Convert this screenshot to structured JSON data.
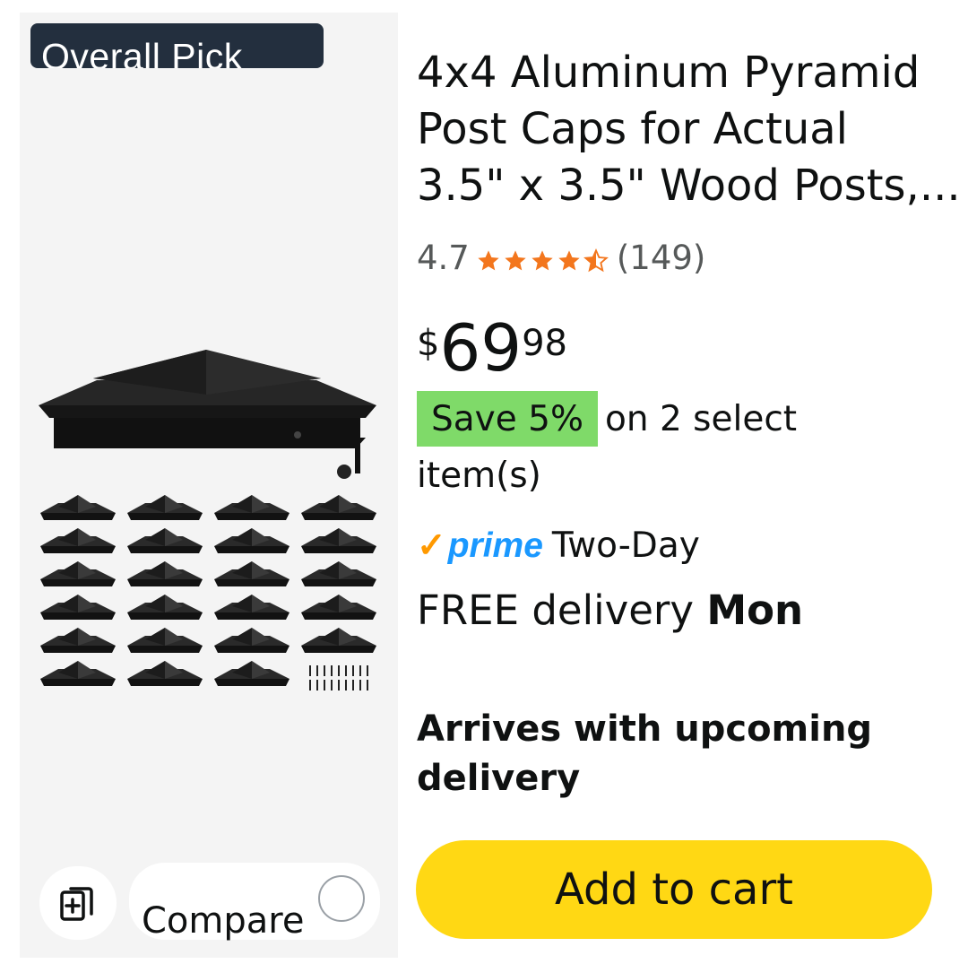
{
  "badge": {
    "label": "Overall Pick",
    "info_icon": "info-icon"
  },
  "product": {
    "title_lines": [
      "4x4 Aluminum Pyramid",
      "Post Caps for Actual",
      "3.5\" x 3.5\" Wood Posts,..."
    ],
    "rating": "4.7",
    "stars": 4.5,
    "review_count": "(149)",
    "price": {
      "currency": "$",
      "whole": "69",
      "fraction": "98"
    },
    "save": {
      "badge": "Save 5%",
      "text": "on 2 select item(s)"
    },
    "prime": {
      "logo": "prime",
      "delivery_type": "Two-Day"
    },
    "delivery": {
      "prefix": "FREE delivery ",
      "day": "Mon"
    },
    "arrives": "Arrives with upcoming delivery"
  },
  "compare": {
    "label": "Compare",
    "icon": "compare-add-icon"
  },
  "cart": {
    "label": "Add to cart"
  },
  "colors": {
    "badge_bg": "#232f3e",
    "star": "#f3761d",
    "save_bg": "#7fda69",
    "prime": "#1a98ff",
    "cart": "#ffd814"
  }
}
